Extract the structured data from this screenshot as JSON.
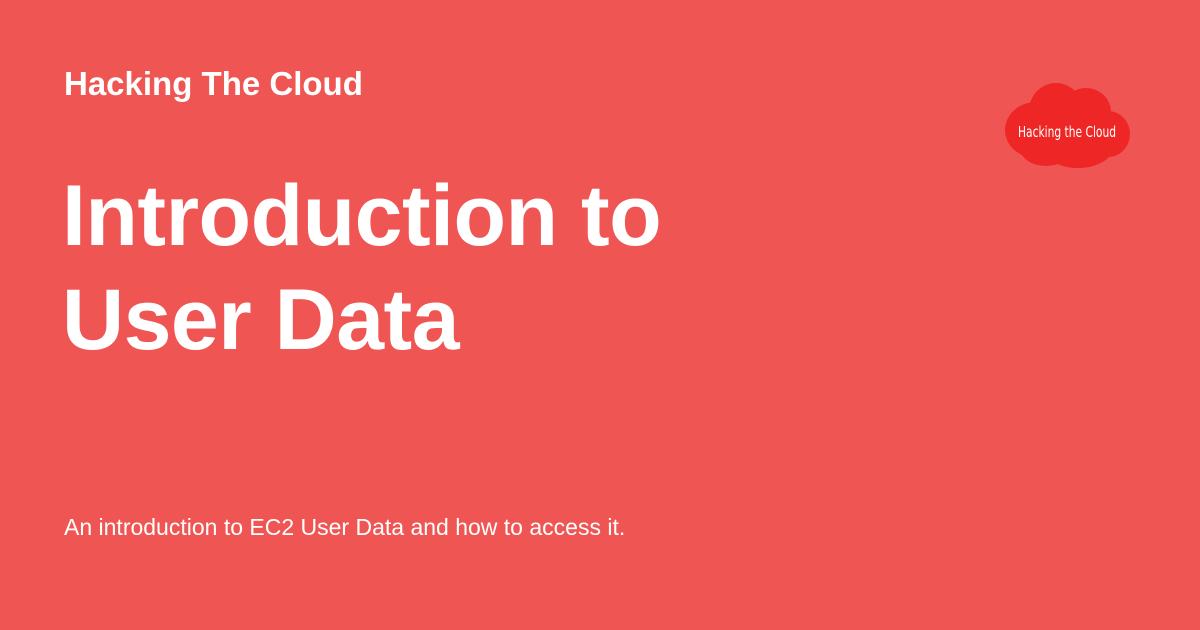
{
  "site": {
    "name": "Hacking The Cloud"
  },
  "page": {
    "title_line_1": "Introduction to",
    "title_line_2": "User Data",
    "description": "An introduction to EC2 User Data and how to access it."
  },
  "logo": {
    "text": "Hacking the Cloud",
    "icon": "cloud-logo-icon",
    "color": "#EE2626"
  },
  "theme": {
    "background": "#EF5552",
    "text_color": "#FFFFFF"
  }
}
